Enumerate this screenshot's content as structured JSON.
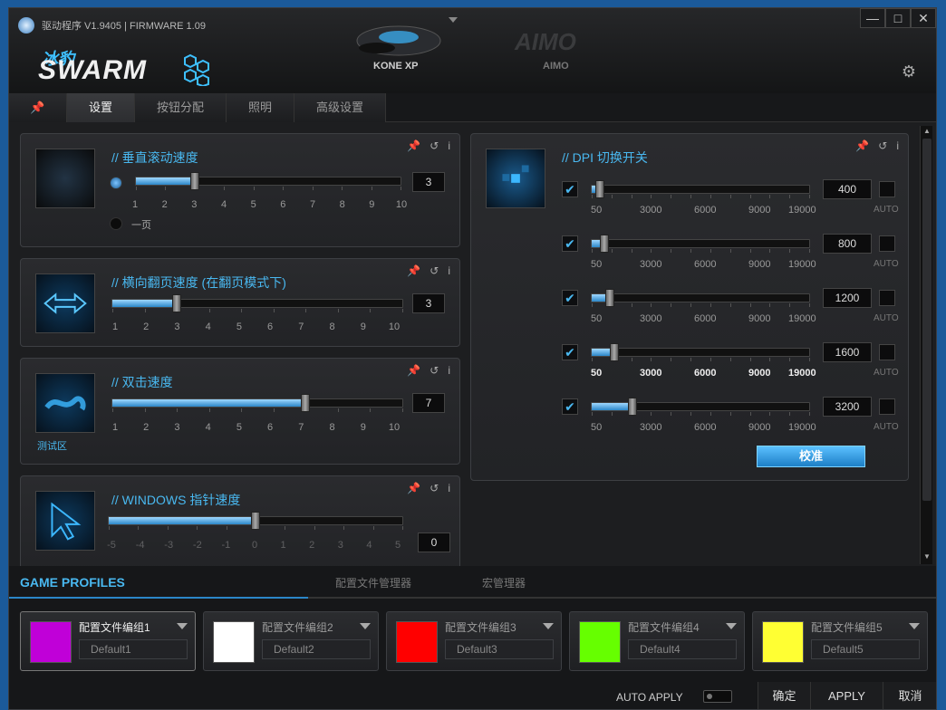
{
  "app": {
    "title": "驱动程序 V1.9405 | FIRMWARE 1.09",
    "brand_cn": "冰豹",
    "brand": "SWARM"
  },
  "devices": [
    {
      "label": "KONE XP"
    },
    {
      "label": "AIMO",
      "logo": "AIMO"
    }
  ],
  "window": {
    "minimize": "—",
    "maximize": "□",
    "close": "✕"
  },
  "tabs": [
    {
      "label": "设置"
    },
    {
      "label": "按钮分配"
    },
    {
      "label": "照明"
    },
    {
      "label": "高级设置"
    }
  ],
  "panels": {
    "vscroll": {
      "title": "// 垂直滚动速度",
      "value": "3",
      "level": 3,
      "ticks": [
        "1",
        "2",
        "3",
        "4",
        "5",
        "6",
        "7",
        "8",
        "9",
        "10"
      ],
      "option_label": "一页"
    },
    "hscroll": {
      "title": "// 横向翻页速度 (在翻页模式下)",
      "value": "3",
      "level": 3,
      "ticks": [
        "1",
        "2",
        "3",
        "4",
        "5",
        "6",
        "7",
        "8",
        "9",
        "10"
      ]
    },
    "dblclick": {
      "title": "// 双击速度",
      "value": "7",
      "level": 7,
      "ticks": [
        "1",
        "2",
        "3",
        "4",
        "5",
        "6",
        "7",
        "8",
        "9",
        "10"
      ],
      "test_label": "测试区"
    },
    "pointer": {
      "title": "// WINDOWS 指针速度",
      "value": "0",
      "level": 0,
      "ticks": [
        "-5",
        "-4",
        "-3",
        "-2",
        "-1",
        "0",
        "1",
        "2",
        "3",
        "4",
        "5"
      ]
    }
  },
  "dpi": {
    "title": "// DPI 切换开关",
    "auto_label": "AUTO",
    "tick_labels": [
      "50",
      "3000",
      "6000",
      "9000",
      "19000"
    ],
    "calibrate": "校准",
    "rows": [
      {
        "value": "400",
        "checked": true
      },
      {
        "value": "800",
        "checked": true
      },
      {
        "value": "1200",
        "checked": true
      },
      {
        "value": "1600",
        "checked": true
      },
      {
        "value": "3200",
        "checked": true
      }
    ]
  },
  "profiles": {
    "title": "GAME PROFILES",
    "tabs": [
      "配置文件管理器",
      "宏管理器"
    ],
    "items": [
      {
        "name": "配置文件编组1",
        "default": "Default1",
        "color": "#c000d8"
      },
      {
        "name": "配置文件编组2",
        "default": "Default2",
        "color": "#ffffff"
      },
      {
        "name": "配置文件编组3",
        "default": "Default3",
        "color": "#ff0000"
      },
      {
        "name": "配置文件编组4",
        "default": "Default4",
        "color": "#66ff00"
      },
      {
        "name": "配置文件编组5",
        "default": "Default5",
        "color": "#ffff33"
      }
    ]
  },
  "footer": {
    "auto_apply": "AUTO APPLY",
    "ok": "确定",
    "apply": "APPLY",
    "cancel": "取消"
  },
  "icons": {
    "pin": "pin-icon",
    "reset": "reset-icon",
    "info": "info-icon",
    "gear": "gear-icon"
  }
}
